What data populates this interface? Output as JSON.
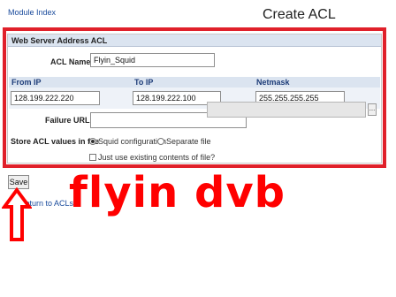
{
  "header": {
    "module_index": "Module Index",
    "title": "Create ACL"
  },
  "panel": {
    "title": "Web Server Address ACL",
    "acl_name_label": "ACL Name",
    "acl_name_value": "Flyin_Squid",
    "from_ip_label": "From IP",
    "to_ip_label": "To IP",
    "netmask_label": "Netmask",
    "from_ip_value": "128.199.222.220",
    "to_ip_value": "128.199.222.100",
    "netmask_value": "255.255.255.255",
    "failure_url_label": "Failure URL",
    "failure_url_value": "",
    "store_label": "Store ACL values in file",
    "squid_config_label": "Squid configuration",
    "separate_file_label": "Separate file",
    "existing_contents_label": "Just use existing contents of file?",
    "browse_label": "..."
  },
  "actions": {
    "save_label": "Save",
    "return_label": "Return to ACLs"
  },
  "overlay": {
    "text": "flyin dvb"
  },
  "colors": {
    "highlight_red": "#e0202a",
    "overlay_red": "#ff0000",
    "header_bg": "#dbe4f0",
    "link_blue": "#1a4b9c"
  }
}
